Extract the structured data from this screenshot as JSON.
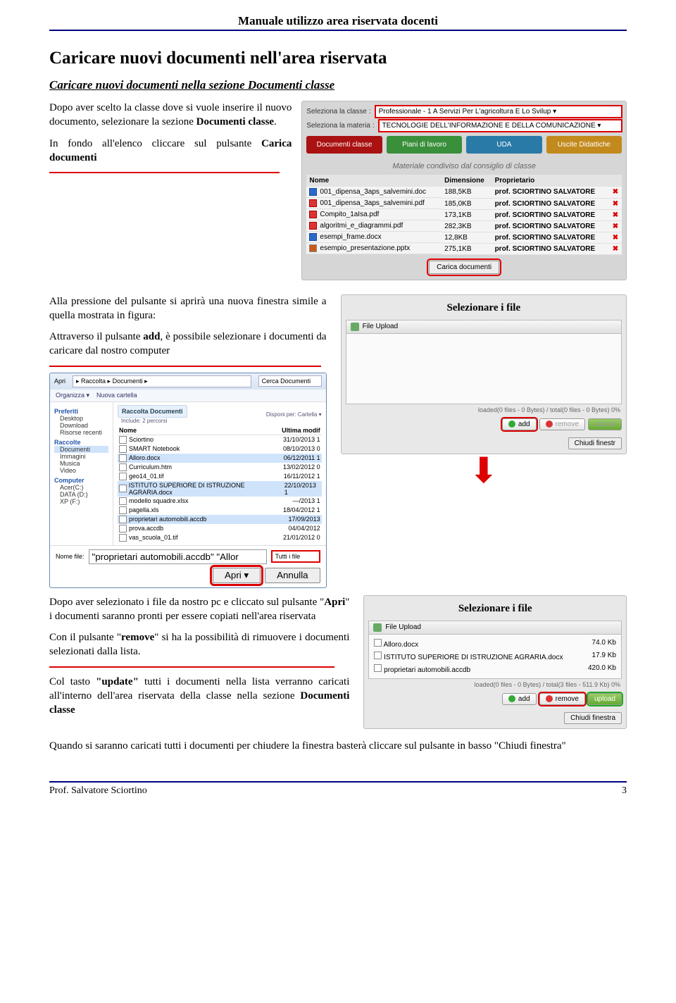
{
  "header": {
    "title": "Manuale utilizzo area riservata docenti"
  },
  "h1": "Caricare nuovi documenti nell'area riservata",
  "h2": "Caricare nuovi documenti nella sezione Documenti classe",
  "intro": {
    "p1a": "Dopo aver scelto la classe dove si vuole inserire il nuovo documento, selezionare la sezione ",
    "p1b": "Documenti classe",
    "p1c": ".",
    "p2a": "In fondo all'elenco cliccare sul pulsante ",
    "p2b": "Carica documenti"
  },
  "shotA": {
    "labelClass": "Seleziona la classe :",
    "valClass": "Professionale - 1 A Servizi Per L'agricoltura E Lo Svilup ▾",
    "labelSubj": "Seleziona la materia :",
    "valSubj": "TECNOLOGIE DELL'INFORMAZIONE E DELLA COMUNICAZIONE ▾",
    "tabs": [
      "Documenti classe",
      "Piani di lavoro",
      "UDA",
      "Uscite Didattiche"
    ],
    "tableTitle": "Materiale condiviso dal consiglio di classe",
    "cols": [
      "Nome",
      "Dimensione",
      "Proprietario"
    ],
    "rows": [
      {
        "icon": "doc",
        "name": "001_dipensa_3aps_salvemini.doc",
        "size": "188,5KB",
        "own": "prof. SCIORTINO SALVATORE"
      },
      {
        "icon": "pdf",
        "name": "001_dipensa_3aps_salvemini.pdf",
        "size": "185,0KB",
        "own": "prof. SCIORTINO SALVATORE"
      },
      {
        "icon": "pdf",
        "name": "Compito_1aIsa.pdf",
        "size": "173,1KB",
        "own": "prof. SCIORTINO SALVATORE"
      },
      {
        "icon": "pdf",
        "name": "algoritmi_e_diagrammi.pdf",
        "size": "282,3KB",
        "own": "prof. SCIORTINO SALVATORE"
      },
      {
        "icon": "doc",
        "name": "esempi_frame.docx",
        "size": "12,8KB",
        "own": "prof. SCIORTINO SALVATORE"
      },
      {
        "icon": "ppt",
        "name": "esempio_presentazione.pptx",
        "size": "275,1KB",
        "own": "prof. SCIORTINO SALVATORE"
      }
    ],
    "btn": "Carica documenti"
  },
  "mid": {
    "p1": "Alla pressione del pulsante si aprirà una nuova finestra simile a quella mostrata in figura:",
    "p2a": "Attraverso il pulsante ",
    "p2b": "add",
    "p2c": ", è possibile selezionare i documenti da caricare dal nostro computer"
  },
  "openDlg": {
    "title": "Apri",
    "crumbs": "▸ Raccolta ▸ Documenti ▸",
    "search": "Cerca Documenti",
    "organize": "Organizza ▾",
    "newfolder": "Nuova cartella",
    "side": {
      "fav": "Preferiti",
      "items1": [
        "Desktop",
        "Download",
        "Risorse recenti"
      ],
      "rac": "Raccolte",
      "items2": [
        "Documenti",
        "Immagini",
        "Musica",
        "Video"
      ],
      "comp": "Computer",
      "items3": [
        "Acer(C:)",
        "DATA (D:)",
        "XP (F:)"
      ]
    },
    "libHeader": "Raccolta Documenti",
    "libSub": "Include: 2 percorsi",
    "disponi": "Disponi per:  Cartella ▾",
    "colName": "Nome",
    "colDate": "Ultima modif",
    "files": [
      {
        "n": "Sciortino",
        "d": "31/10/2013 1"
      },
      {
        "n": "SMART Notebook",
        "d": "08/10/2013 0"
      },
      {
        "n": "Alloro.docx",
        "d": "06/12/2011 1",
        "hl": true
      },
      {
        "n": "Curriculum.htm",
        "d": "13/02/2012 0"
      },
      {
        "n": "geo14_01.tif",
        "d": "16/11/2012 1"
      },
      {
        "n": "ISTITUTO SUPERIORE DI ISTRUZIONE AGRARIA.docx",
        "d": "22/10/2013 1",
        "hl": true
      },
      {
        "n": "modello squadre.xlsx",
        "d": "—/2013 1"
      },
      {
        "n": "pagella.xls",
        "d": "18/04/2012 1"
      },
      {
        "n": "proprietari automobili.accdb",
        "d": "17/09/2013",
        "hl": true
      },
      {
        "n": "prova.accdb",
        "d": "04/04/2012"
      },
      {
        "n": "vas_scuola_01.tif",
        "d": "21/01/2012 0"
      }
    ],
    "nameLabel": "Nome file:",
    "nameVal": "\"proprietari automobili.accdb\" \"Allor",
    "filetype": "Tutti i file",
    "btnOpen": "Apri ▾",
    "btnCancel": "Annulla"
  },
  "upload1": {
    "title": "Selezionare i file",
    "panelTitle": "File Upload",
    "status": "loaded(0 files - 0 Bytes) / total(0 files - 0 Bytes) 0%",
    "btnAdd": "add",
    "btnRemove": "remove",
    "btnUpload": "upload",
    "btnClose": "Chiudi finestr"
  },
  "lower": {
    "p1a": "Dopo aver selezionato i file da nostro pc e cliccato sul pulsante \"",
    "p1b": "Apri",
    "p1c": "\" i documenti saranno pronti per essere copiati nell'area riservata",
    "p2a": "Con il pulsante \"",
    "p2b": "remove",
    "p2c": "\" si ha la possibilità di rimuovere i documenti selezionati dalla lista.",
    "p3a": "Col tasto ",
    "p3b": "\"update\"",
    "p3c": " tutti i documenti nella lista verranno caricati all'interno dell'area riservata della classe nella sezione ",
    "p3d": "Documenti classe"
  },
  "upload2": {
    "title": "Selezionare i file",
    "panelTitle": "File Upload",
    "rows": [
      {
        "n": "Alloro.docx",
        "s": "74.0 Kb"
      },
      {
        "n": "ISTITUTO SUPERIORE DI ISTRUZIONE AGRARIA.docx",
        "s": "17.9 Kb"
      },
      {
        "n": "proprietari automobili.accdb",
        "s": "420.0 Kb"
      }
    ],
    "status": "loaded(0 files - 0 Bytes) / total(3 files - 511.9 Kb) 0%",
    "btnAdd": "add",
    "btnRemove": "remove",
    "btnUpload": "upload",
    "btnClose": "Chiudi finestra"
  },
  "closing": "Quando si saranno caricati tutti i documenti per chiudere la finestra basterà cliccare sul pulsante in basso \"Chiudi finestra\"",
  "footer": {
    "author": "Prof. Salvatore Sciortino",
    "page": "3"
  }
}
